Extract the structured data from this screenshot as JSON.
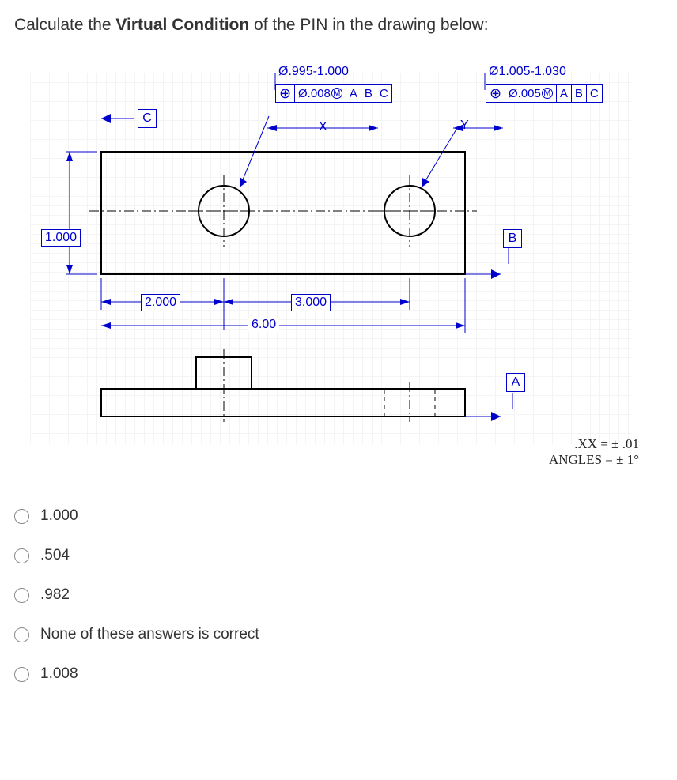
{
  "question_prefix": "Calculate the ",
  "question_bold": "Virtual Condition",
  "question_suffix": " of the PIN in the drawing below:",
  "drawing": {
    "hole_dia": "Ø.995-1.000",
    "hole_fcf": {
      "tol": "Ø.008",
      "mod": "M",
      "d1": "A",
      "d2": "B",
      "d3": "C"
    },
    "pin_dia": "Ø1.005-1.030",
    "pin_fcf": {
      "tol": "Ø.005",
      "mod": "M",
      "d1": "A",
      "d2": "B",
      "d3": "C"
    },
    "dim_height": "1.000",
    "dim_2": "2.000",
    "dim_3": "3.000",
    "dim_6": "6.00",
    "x": "X",
    "y": "Y",
    "datum_a": "A",
    "datum_b": "B",
    "datum_c": "C"
  },
  "tolerance_note": {
    "line1": ".XX  =  ± .01",
    "line2": "ANGLES =  ±  1°"
  },
  "answers": [
    "1.000",
    ".504",
    ".982",
    "None of these answers is correct",
    "1.008"
  ]
}
